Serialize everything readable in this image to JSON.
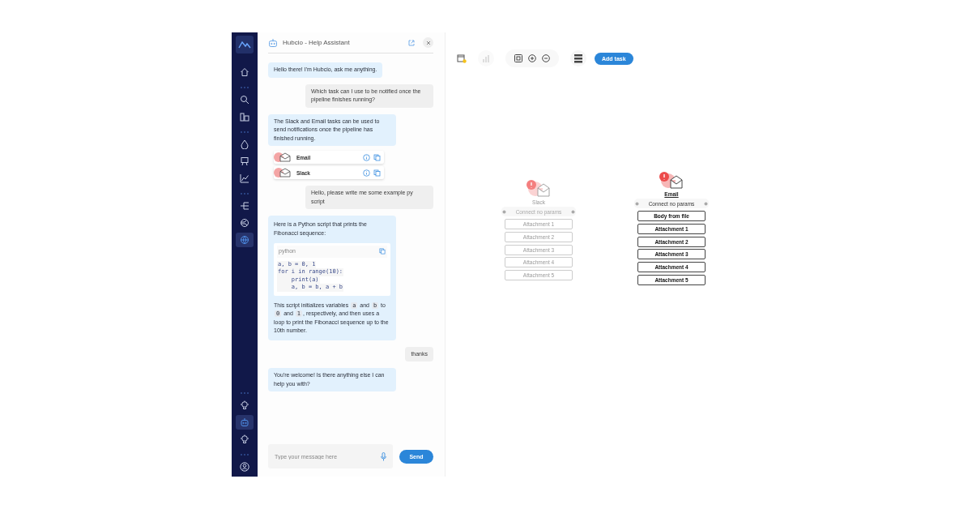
{
  "sidebar": {
    "top_items": [
      {
        "selected": false
      },
      {
        "selected": false
      },
      {
        "selected": false
      },
      {
        "selected": false
      },
      {
        "selected": false
      },
      {
        "selected": false
      },
      {
        "selected": false
      },
      {
        "selected": false
      },
      {
        "selected": true
      }
    ],
    "bottom_items": [
      {
        "selected": false
      },
      {
        "selected": true
      },
      {
        "selected": false
      }
    ]
  },
  "assistant": {
    "title": "Hubcio - Help Assistant",
    "messages": [
      {
        "from_user": false,
        "kind": "text",
        "text": "Hello there! I'm Hubcio, ask me anything."
      },
      {
        "from_user": true,
        "kind": "text",
        "text": "Which task can I use to be notified once the pipeline finishes running?"
      },
      {
        "from_user": false,
        "kind": "text",
        "text": "The Slack and Email tasks can be used to send notifications once the pipeline has finished running."
      },
      {
        "kind": "tasks",
        "tasks": [
          {
            "name": "Email"
          },
          {
            "name": "Slack"
          }
        ]
      },
      {
        "from_user": true,
        "kind": "text",
        "text": "Hello, please write me some example py script"
      },
      {
        "kind": "code",
        "intro": "Here is a Python script that prints the Fibonacci sequence:",
        "language": "python",
        "lines": [
          "a, b = 0, 1",
          "for i in range(10):",
          "    print(a)",
          "    a, b = b, a + b"
        ],
        "outro": [
          "This script initializes variables",
          "a",
          "and",
          "b",
          "to",
          "0",
          "and",
          "1",
          ", respectively, and then uses a loop to print the Fibonacci sequence up to the 10th number."
        ]
      },
      {
        "from_user": true,
        "kind": "text",
        "text": "thanks"
      },
      {
        "from_user": false,
        "kind": "text",
        "text": "You're welcome! Is there anything else I can help you with?"
      }
    ],
    "input": {
      "placeholder": "Type your message here"
    },
    "send_label": "Send"
  },
  "toolbar": {
    "add_task_label": "Add task",
    "chart_disabled": true
  },
  "nodes": [
    {
      "name": "Slack",
      "active": false,
      "connect_label": "Connect no params",
      "params": [
        "Attachment 1",
        "Attachment 2",
        "Attachment 3",
        "Attachment 4",
        "Attachment 5"
      ]
    },
    {
      "name": "Email",
      "active": true,
      "connect_label": "Connect no params",
      "params": [
        "Body from file",
        "Attachment 1",
        "Attachment 2",
        "Attachment 3",
        "Attachment 4",
        "Attachment 5"
      ]
    }
  ]
}
